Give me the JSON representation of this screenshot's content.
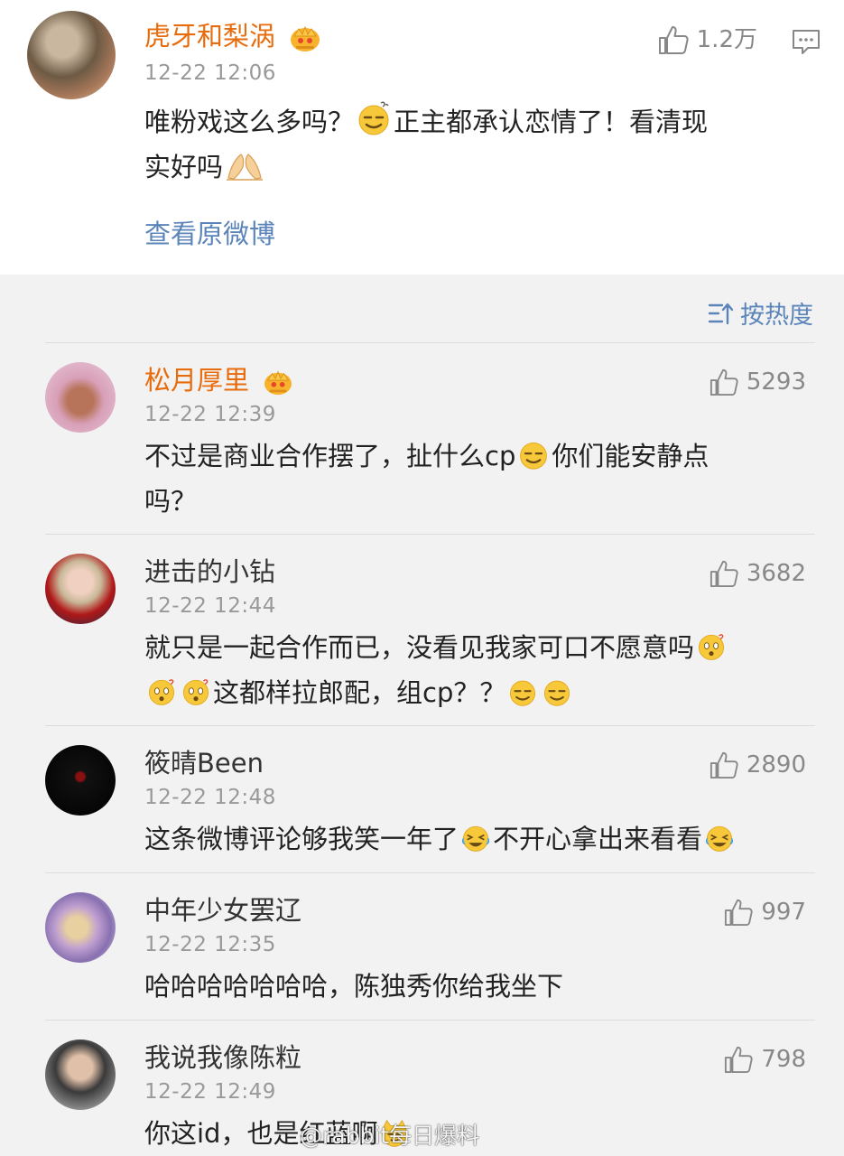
{
  "post": {
    "author": "虎牙和梨涡",
    "time": "12-22 12:06",
    "likes": "1.2万",
    "text_line1": "唯粉戏这么多吗？",
    "text_line1b": "正主都承认恋情了！看清现",
    "text_line2": "实好吗",
    "view_original": "查看原微博"
  },
  "sort": {
    "label": "按热度"
  },
  "comments": [
    {
      "author": "松月厚里",
      "time": "12-22 12:39",
      "likes": "5293",
      "line1a": "不过是商业合作摆了，扯什么cp",
      "line1b": "你们能安静点",
      "line2": "吗？"
    },
    {
      "author": "进击的小钻",
      "time": "12-22 12:44",
      "likes": "3682",
      "line1": "就只是一起合作而已，没看见我家可口不愿意吗",
      "line2": "这都样拉郎配，组cp？？"
    },
    {
      "author": "筱晴Been",
      "time": "12-22 12:48",
      "likes": "2890",
      "line1a": "这条微博评论够我笑一年了",
      "line1b": "不开心拿出来看看"
    },
    {
      "author": "中年少女罢辽",
      "time": "12-22 12:35",
      "likes": "997",
      "line1": "哈哈哈哈哈哈哈，陈独秀你给我坐下"
    },
    {
      "author": "我说我像陈粒",
      "time": "12-22 12:49",
      "likes": "798",
      "line1": "你这id，也是红蓝啊"
    }
  ],
  "watermark": "@rabbit每日爆料",
  "colors": {
    "vip_name": "#e86b0c",
    "link": "#5b85ba",
    "meta": "#999999",
    "background": "#f2f2f2"
  },
  "icons": [
    "crown-icon",
    "thumb-up-icon",
    "comment-icon",
    "sort-icon",
    "smirk-emoji-icon",
    "pray-emoji-icon",
    "wondering-emoji-icon",
    "laugh-cry-emoji-icon",
    "cat-emoji-icon"
  ]
}
